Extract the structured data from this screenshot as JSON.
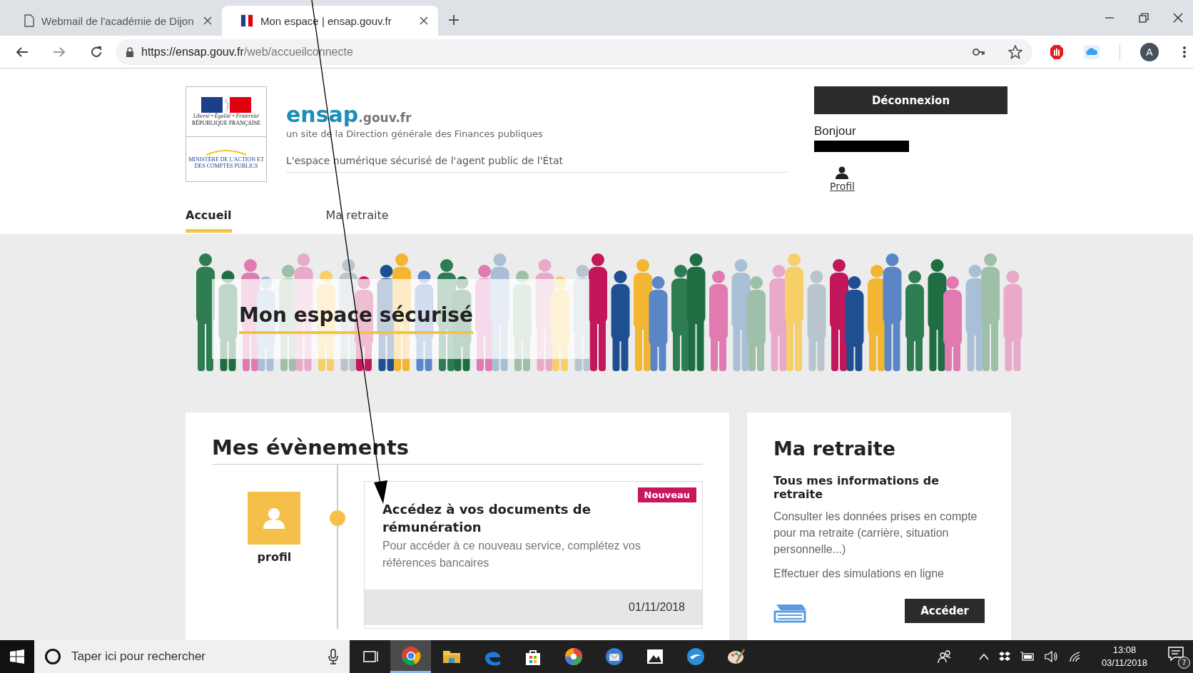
{
  "browser": {
    "tabs": [
      {
        "kind": "document",
        "title": "Webmail de l'académie de Dijon",
        "selected": false
      },
      {
        "kind": "site",
        "title": "Mon espace | ensap.gouv.fr",
        "selected": true
      }
    ],
    "url_host": "https://ensap.gouv.fr",
    "url_path": "/web/accueilconnecte",
    "account": "A"
  },
  "site": {
    "logo": {
      "motto": "Liberté • Égalité • Fraternité",
      "republic": "RÉPUBLIQUE FRANÇAISE",
      "ministry": "MINISTÈRE DE L'ACTION ET DES COMPTES PUBLICS"
    },
    "brand": {
      "name": "ensap",
      "domain": ".gouv.fr",
      "subtitle": "un site de la Direction générale des Finances publiques",
      "tagline": "L'espace numérique sécurisé de l'agent public de l'État"
    },
    "user": {
      "logout": "Déconnexion",
      "greeting": "Bonjour",
      "profile": "Profil"
    },
    "nav": [
      {
        "label": "Accueil",
        "selected": true
      },
      {
        "label": "Ma retraite",
        "selected": false
      }
    ],
    "banner": {
      "title": "Mon espace sécurisé"
    },
    "events": {
      "title": "Mes évènements",
      "items": [
        {
          "icon_label": "profil",
          "badge": "Nouveau",
          "title": "Accédez à vos documents de rémunération",
          "description": "Pour accéder à ce nouveau service, complétez vos références bancaires",
          "date": "01/11/2018"
        }
      ]
    },
    "retirement": {
      "title": "Ma retraite",
      "subtitle": "Tous mes informations de retraite",
      "paragraphs": [
        "Consulter les données prises en compte pour ma retraite (carrière, situation personnelle...)",
        "Effectuer des simulations en ligne"
      ],
      "button": "Accéder"
    }
  },
  "taskbar": {
    "search_placeholder": "Taper ici pour rechercher",
    "apps": [
      {
        "kind": "taskview",
        "selected": false
      },
      {
        "kind": "chrome",
        "selected": true
      },
      {
        "kind": "folder",
        "selected": false
      },
      {
        "kind": "edge",
        "selected": false
      },
      {
        "kind": "store",
        "selected": false
      },
      {
        "kind": "pinwheel",
        "selected": false
      },
      {
        "kind": "mail",
        "selected": false
      },
      {
        "kind": "photos",
        "selected": false
      },
      {
        "kind": "bird",
        "selected": false
      },
      {
        "kind": "palette",
        "selected": false
      }
    ],
    "time": "13:08",
    "date": "03/11/2018",
    "notifications": "7"
  }
}
